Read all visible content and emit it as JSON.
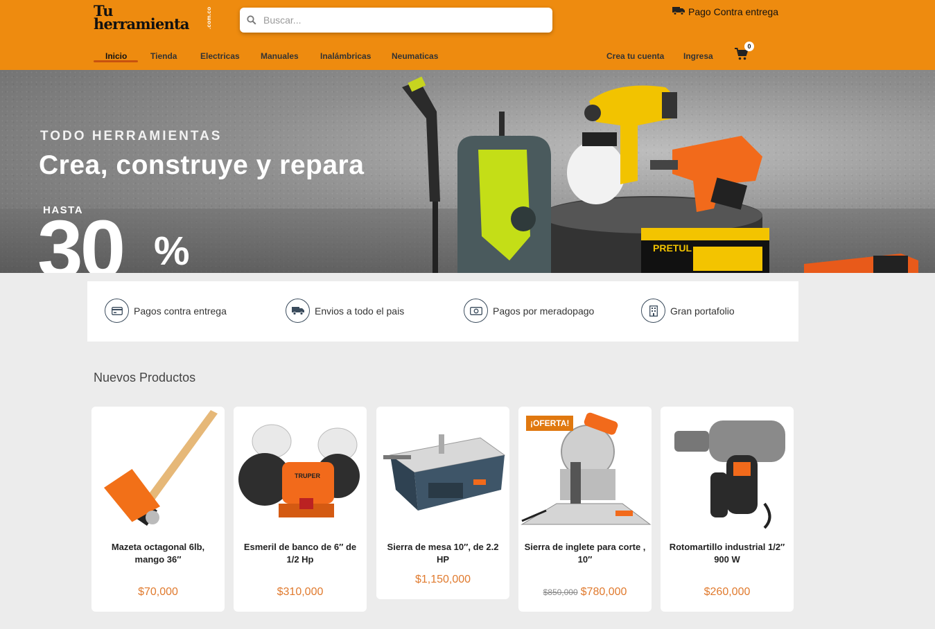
{
  "brand": {
    "logo_line1": "Tu",
    "logo_line2": "herramienta",
    "logo_domain": ".com.co"
  },
  "search": {
    "placeholder": "Buscar..."
  },
  "header": {
    "cod_label": "Pago Contra entrega"
  },
  "nav": {
    "items": [
      "Inicio",
      "Tienda",
      "Electricas",
      "Manuales",
      "Inalámbricas",
      "Neumaticas"
    ],
    "active": "Inicio",
    "create_account": "Crea tu cuenta",
    "login": "Ingresa",
    "cart_count": "0"
  },
  "hero": {
    "kicker": "TODO HERRAMIENTAS",
    "headline": "Crea, construye y repara",
    "hasta": "HASTA",
    "discount": "30",
    "percent": "%"
  },
  "features": [
    {
      "label": "Pagos contra entrega",
      "icon": "credit-card-icon"
    },
    {
      "label": "Envios a todo el pais",
      "icon": "truck-icon"
    },
    {
      "label": "Pagos por meradopago",
      "icon": "cash-icon"
    },
    {
      "label": "Gran portafolio",
      "icon": "building-icon"
    }
  ],
  "products_section": {
    "title": "Nuevos Productos",
    "products": [
      {
        "name": "Mazeta octagonal 6lb, mango 36″",
        "price": "$70,000",
        "old_price": "",
        "badge": ""
      },
      {
        "name": "Esmeril de banco de 6″ de 1/2 Hp",
        "price": "$310,000",
        "old_price": "",
        "badge": ""
      },
      {
        "name": "Sierra de mesa 10″, de 2.2 HP",
        "price": "$1,150,000",
        "old_price": "",
        "badge": ""
      },
      {
        "name": "Sierra de inglete para corte , 10″",
        "price": "$780,000",
        "old_price": "$850,000",
        "badge": "¡OFERTA!"
      },
      {
        "name": "Rotomartillo industrial 1/2″ 900 W",
        "price": "$260,000",
        "old_price": "",
        "badge": ""
      }
    ]
  },
  "colors": {
    "header_bg": "#ee8b0f",
    "accent": "#e07a2e",
    "badge_bg": "#e0780f",
    "active_underline": "#c7520f"
  }
}
